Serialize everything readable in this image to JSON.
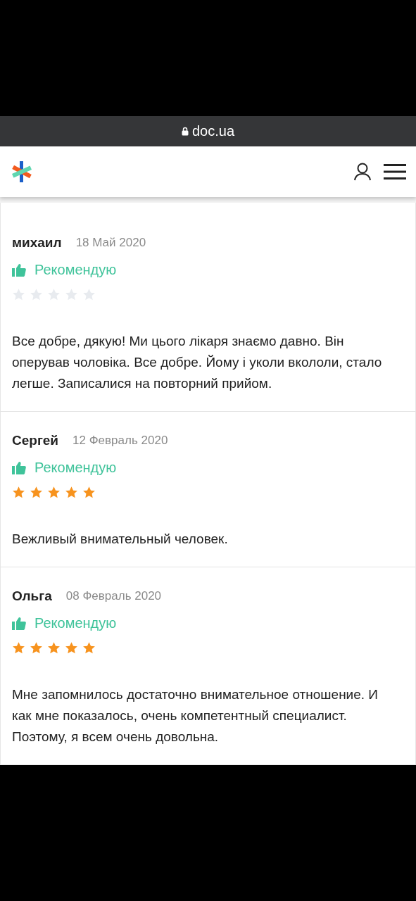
{
  "address_bar": {
    "url": "doc.ua"
  },
  "reviews": [
    {
      "author": "михаил",
      "date": "18 Май 2020",
      "recommended": true,
      "recommend_label": "Рекомендую",
      "stars": 0,
      "text": "Все добре, дякую! Ми цього лікаря знаємо давно. Він оперував чоловіка. Все добре. Йому і уколи вкололи, стало легше. Записалися на повторний прийом."
    },
    {
      "author": "Сергей",
      "date": "12 Февраль 2020",
      "recommended": true,
      "recommend_label": "Рекомендую",
      "stars": 5,
      "text": "Вежливый внимательный человек."
    },
    {
      "author": "Ольга",
      "date": "08 Февраль 2020",
      "recommended": true,
      "recommend_label": "Рекомендую",
      "stars": 5,
      "text": "Мне запомнилось достаточно внимательное отношение. И как мне показалось, очень компетентный специалист. Поэтому, я всем очень довольна."
    }
  ]
}
